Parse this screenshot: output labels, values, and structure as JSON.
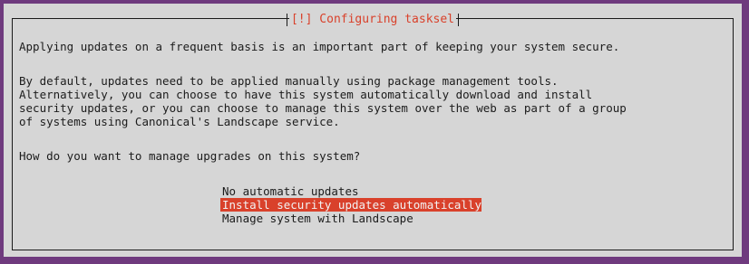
{
  "dialog": {
    "title": "[!] Configuring tasksel",
    "paragraph1": "Applying updates on a frequent basis is an important part of keeping your system secure.",
    "paragraph2_lines": [
      "By default, updates need to be applied manually using package management tools.",
      "Alternatively, you can choose to have this system automatically download and install",
      "security updates, or you can choose to manage this system over the web as part of a group",
      "of systems using Canonical's Landscape service."
    ],
    "question": "How do you want to manage upgrades on this system?",
    "options": [
      {
        "label": "No automatic updates",
        "selected": false
      },
      {
        "label": "Install security updates automatically",
        "selected": true
      },
      {
        "label": "Manage system with Landscape",
        "selected": false
      }
    ]
  },
  "colors": {
    "background": "#6f3a7e",
    "dialog": "#d6d6d6",
    "accent": "#d9412b",
    "text": "#1c1c1c"
  }
}
